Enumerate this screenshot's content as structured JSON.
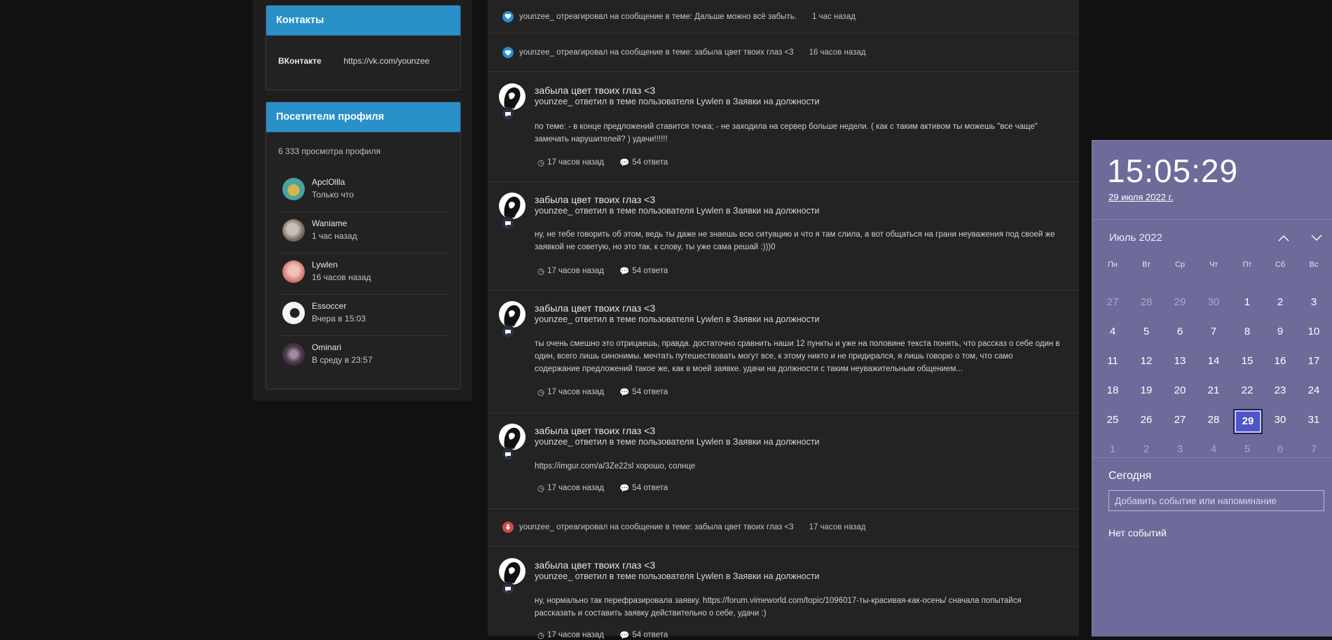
{
  "sidebar": {
    "contacts": {
      "header": "Контакты",
      "label": "ВКонтакте",
      "value": "https://vk.com/younzee"
    },
    "visitors": {
      "header": "Посетители профиля",
      "views": "6 333 просмотра профиля",
      "items": [
        {
          "name": "ApclOllla",
          "time": "Только что"
        },
        {
          "name": "Waniame",
          "time": "1 час назад"
        },
        {
          "name": "Lywlen",
          "time": "16 часов назад"
        },
        {
          "name": "Essoccer",
          "time": "Вчера в 15:03"
        },
        {
          "name": "Ominari",
          "time": "В среду в 23:57"
        }
      ]
    }
  },
  "feed": {
    "reactions": [
      {
        "text": "younzee_ отреагировал на сообщение в теме: Дальше можно всё забыть.",
        "time": "1 час назад",
        "icon": "heart-icon"
      },
      {
        "text": "younzee_ отреагировал на сообщение в теме: забыла цвет твоих глаз <3",
        "time": "16 часов назад",
        "icon": "heart-icon"
      },
      {
        "text": "younzee_ отреагировал на сообщение в теме: забыла цвет твоих глаз <3",
        "time": "17 часов назад",
        "icon": "dislike-icon"
      }
    ],
    "posts": [
      {
        "title": "забыла цвет твоих глаз <3",
        "subtitle": "younzee_ ответил в теме пользователя Lywlen в Заявки на должности",
        "body": "по теме: - в конце предложений ставится точка; - не заходила на сервер больше недели. ( как с таким активом ты можешь \"все чаще\" замечать нарушителей? ) удачи!!!!!!",
        "time": "17 часов назад",
        "replies": "54 ответа"
      },
      {
        "title": "забыла цвет твоих глаз <3",
        "subtitle": "younzee_ ответил в теме пользователя Lywlen в Заявки на должности",
        "body": "ну, не тебе говорить об этом, ведь ты даже не знаешь всю ситуацию и что я там слила, а вот общаться на грани неуважения под своей же заявкой не советую, но это так, к слову, ты уже сама решай :)))0",
        "time": "17 часов назад",
        "replies": "54 ответа"
      },
      {
        "title": "забыла цвет твоих глаз <3",
        "subtitle": "younzee_ ответил в теме пользователя Lywlen в Заявки на должности",
        "body": "ты очень смешно это отрицаешь, правда. достаточно сравнить наши 12 пункты и уже на половине текста понять, что рассказ о себе один в один, всего лишь синонимы. мечтать путешествовать могут все, к этому никто и не придирался, я лишь говорю о том, что само содержание предложений такое же, как в моей заявке. удачи на должности с таким неуважительным общением...",
        "time": "17 часов назад",
        "replies": "54 ответа"
      },
      {
        "title": "забыла цвет твоих глаз <3",
        "subtitle": "younzee_ ответил в теме пользователя Lywlen в Заявки на должности",
        "body": "https://imgur.com/a/3Ze22sl хорошо, солнце",
        "time": "17 часов назад",
        "replies": "54 ответа"
      },
      {
        "title": "забыла цвет твоих глаз <3",
        "subtitle": "younzee_ ответил в теме пользователя Lywlen в Заявки на должности",
        "body": "ну, нормально так перефразировала заявку. https://forum.vimeworld.com/topic/1096017-ты-красивая-как-осень/ сначала попытайся рассказать и составить заявку действительно о себе, удачи :)",
        "time": "17 часов назад",
        "replies": "54 ответа"
      }
    ]
  },
  "calendar": {
    "clock": "15:05:29",
    "date": "29 июля 2022 г.",
    "month": "Июль 2022",
    "weekdays": [
      "Пн",
      "Вт",
      "Ср",
      "Чт",
      "Пт",
      "Сб",
      "Вс"
    ],
    "weeks": [
      [
        "27",
        "28",
        "29",
        "30",
        "1",
        "2",
        "3"
      ],
      [
        "4",
        "5",
        "6",
        "7",
        "8",
        "9",
        "10"
      ],
      [
        "11",
        "12",
        "13",
        "14",
        "15",
        "16",
        "17"
      ],
      [
        "18",
        "19",
        "20",
        "21",
        "22",
        "23",
        "24"
      ],
      [
        "25",
        "26",
        "27",
        "28",
        "29",
        "30",
        "31"
      ],
      [
        "1",
        "2",
        "3",
        "4",
        "5",
        "6",
        "7"
      ]
    ],
    "selected": "29",
    "today_label": "Сегодня",
    "event_placeholder": "Добавить событие или напоминание",
    "no_events": "Нет событий"
  }
}
